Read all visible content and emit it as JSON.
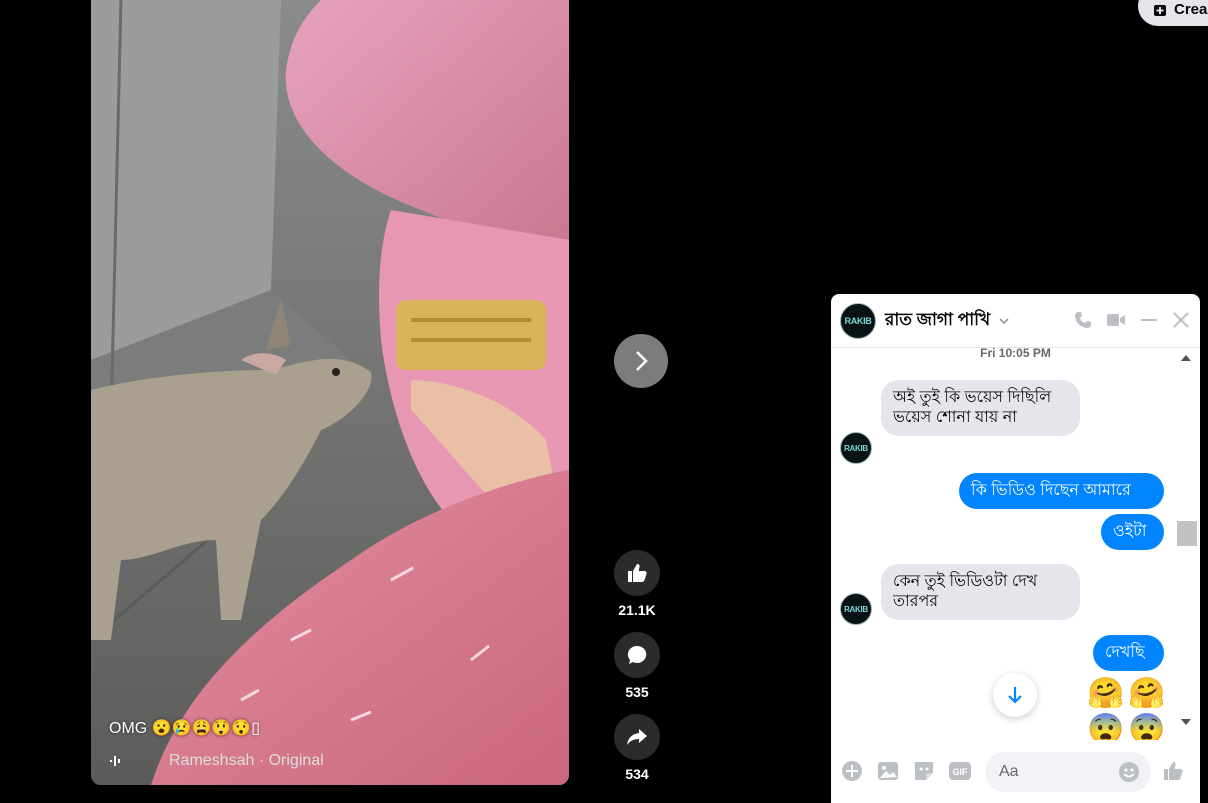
{
  "topbar": {
    "create_label": "Crea"
  },
  "video": {
    "caption": "OMG 😮😢😩😲😯▯",
    "author": "Rameshsah · Original"
  },
  "actions": {
    "likes": "21.1K",
    "comments": "535",
    "shares": "534"
  },
  "chat": {
    "name": "রাত জাগা পাখি",
    "avatar_text": "RAKIB",
    "timestamp": "Fri 10:05 PM",
    "messages": [
      {
        "dir": "in",
        "text": "অই তুই কি ভয়েস দিছিলি ভয়েস শোনা যায় না"
      },
      {
        "dir": "out",
        "text": "কি ভিডিও দিছেন আমারে"
      },
      {
        "dir": "out",
        "text": "ওইটা"
      },
      {
        "dir": "in",
        "text": "কেন তুই ভিডিওটা দেখ তারপর"
      },
      {
        "dir": "out",
        "text": "দেখছি"
      }
    ],
    "emojis_row1": "🤗🤗",
    "emojis_row2": "😨😨",
    "input_placeholder": "Aa"
  },
  "colors": {
    "accent": "#0084ff",
    "incoming": "#e4e6eb"
  }
}
